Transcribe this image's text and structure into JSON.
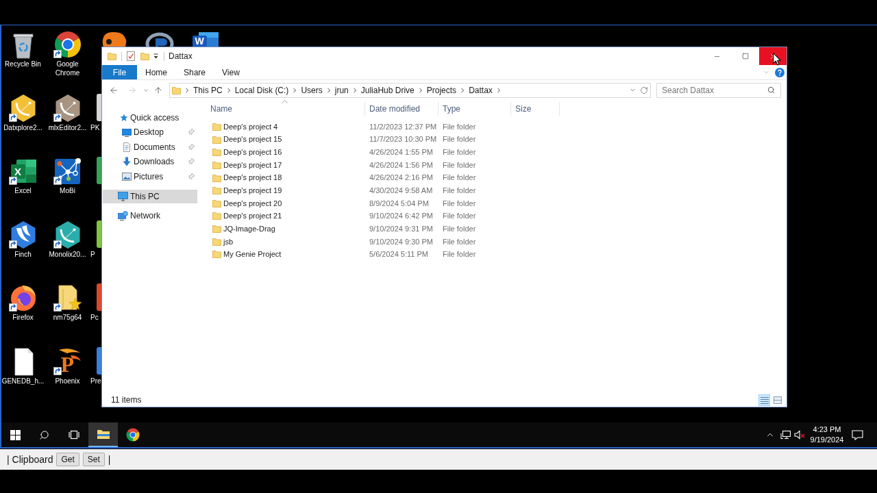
{
  "desktop": {
    "columns": [
      [
        {
          "label": "Recycle Bin",
          "kind": "bin",
          "shortcut": false
        },
        {
          "label": "Datxplore2...",
          "kind": "hexapp",
          "color": "#f2c037",
          "shortcut": true
        },
        {
          "label": "Excel",
          "kind": "excel",
          "letter": "X",
          "shortcut": true
        },
        {
          "label": "Finch",
          "kind": "bird",
          "shortcut": true
        },
        {
          "label": "Firefox",
          "kind": "firefox",
          "shortcut": true
        },
        {
          "label": "GENEDB_h...",
          "kind": "document",
          "shortcut": false
        }
      ],
      [
        {
          "label": "Google Chrome",
          "kind": "chrome",
          "shortcut": true
        },
        {
          "label": "mlxEditor2...",
          "kind": "hexapp",
          "color": "#a89482",
          "shortcut": true
        },
        {
          "label": "MoBi",
          "kind": "network",
          "shortcut": true
        },
        {
          "label": "Monolix20...",
          "kind": "hexapp",
          "color": "#2aaeac",
          "shortcut": true
        },
        {
          "label": "nm75g64",
          "kind": "starfolder",
          "shortcut": true
        },
        {
          "label": "Phoenix",
          "kind": "phoenix",
          "letter": "P",
          "shortcut": true
        }
      ]
    ],
    "top_row": [
      {
        "kind": "blob"
      },
      {
        "kind": "ring"
      },
      {
        "kind": "word",
        "letter": "W"
      }
    ],
    "partial_column": [
      {
        "label": "PK",
        "color": "#d6d6d6"
      },
      {
        "color": "#3ca05a"
      },
      {
        "label": "P",
        "color": "#82c341"
      },
      {
        "label": "Pc",
        "color": "#d84a2f"
      },
      {
        "label": "Pre",
        "color": "#3c7fd9"
      }
    ]
  },
  "window": {
    "title": "Dattax",
    "controls": [
      {
        "kind": "minimize",
        "hovered": false
      },
      {
        "kind": "maximize",
        "hovered": false
      },
      {
        "kind": "close",
        "hovered": true
      }
    ],
    "ribbon": [
      {
        "label": "File",
        "kind": "menu"
      },
      {
        "label": "Home",
        "kind": "tab"
      },
      {
        "label": "Share",
        "kind": "tab"
      },
      {
        "label": "View",
        "kind": "tab"
      }
    ],
    "breadcrumb": [
      "This PC",
      "Local Disk (C:)",
      "Users",
      "jrun",
      "JuliaHub Drive",
      "Projects",
      "Dattax"
    ],
    "search": {
      "placeholder": "Search Dattax"
    },
    "navigation": [
      {
        "label": "Quick access",
        "kind": "star",
        "selected": false,
        "children": [
          {
            "label": "Desktop",
            "kind": "desktop",
            "pinned": true,
            "selected": false
          },
          {
            "label": "Documents",
            "kind": "documents",
            "pinned": true,
            "selected": false
          },
          {
            "label": "Downloads",
            "kind": "downloads",
            "pinned": true,
            "selected": false
          },
          {
            "label": "Pictures",
            "kind": "pictures",
            "pinned": true,
            "selected": false
          }
        ]
      },
      {
        "label": "This PC",
        "kind": "pc",
        "selected": true
      },
      {
        "label": "Network",
        "kind": "network",
        "selected": false
      }
    ],
    "columns": [
      {
        "label": "Name",
        "sorted": true
      },
      {
        "label": "Date modified",
        "sorted": false
      },
      {
        "label": "Type",
        "sorted": false
      },
      {
        "label": "Size",
        "sorted": false
      }
    ],
    "rows": [
      {
        "name": "Deep's project 4",
        "date_modified": "11/2/2023 12:37 PM",
        "type": "File folder"
      },
      {
        "name": "Deep's project 15",
        "date_modified": "11/7/2023 10:30 PM",
        "type": "File folder"
      },
      {
        "name": "Deep's project 16",
        "date_modified": "4/26/2024 1:55 PM",
        "type": "File folder"
      },
      {
        "name": "Deep's project 17",
        "date_modified": "4/26/2024 1:56 PM",
        "type": "File folder"
      },
      {
        "name": "Deep's project 18",
        "date_modified": "4/26/2024 2:16 PM",
        "type": "File folder"
      },
      {
        "name": "Deep's project 19",
        "date_modified": "4/30/2024 9:58 AM",
        "type": "File folder"
      },
      {
        "name": "Deep's project 20",
        "date_modified": "8/9/2024 5:04 PM",
        "type": "File folder"
      },
      {
        "name": "Deep's project 21",
        "date_modified": "9/10/2024 6:42 PM",
        "type": "File folder"
      },
      {
        "name": "JQ-Image-Drag",
        "date_modified": "9/10/2024 9:31 PM",
        "type": "File folder"
      },
      {
        "name": "jsb",
        "date_modified": "9/10/2024 9:30 PM",
        "type": "File folder"
      },
      {
        "name": "My Genie Project",
        "date_modified": "5/6/2024 5:11 PM",
        "type": "File folder"
      }
    ],
    "status": "11 items",
    "views": [
      {
        "kind": "details",
        "selected": true
      },
      {
        "kind": "tiles",
        "selected": false
      }
    ]
  },
  "taskbar": {
    "apps": [
      {
        "kind": "start",
        "active": false
      },
      {
        "kind": "search",
        "active": false
      },
      {
        "kind": "taskview",
        "active": false
      },
      {
        "kind": "explorer",
        "active": true
      },
      {
        "kind": "browser",
        "active": false
      }
    ],
    "time": "4:23 PM",
    "date": "9/19/2024",
    "volume_muted": true
  },
  "clipboard_bar": {
    "label": "| Clipboard",
    "buttons": [
      "Get",
      "Set"
    ],
    "end": "|"
  }
}
